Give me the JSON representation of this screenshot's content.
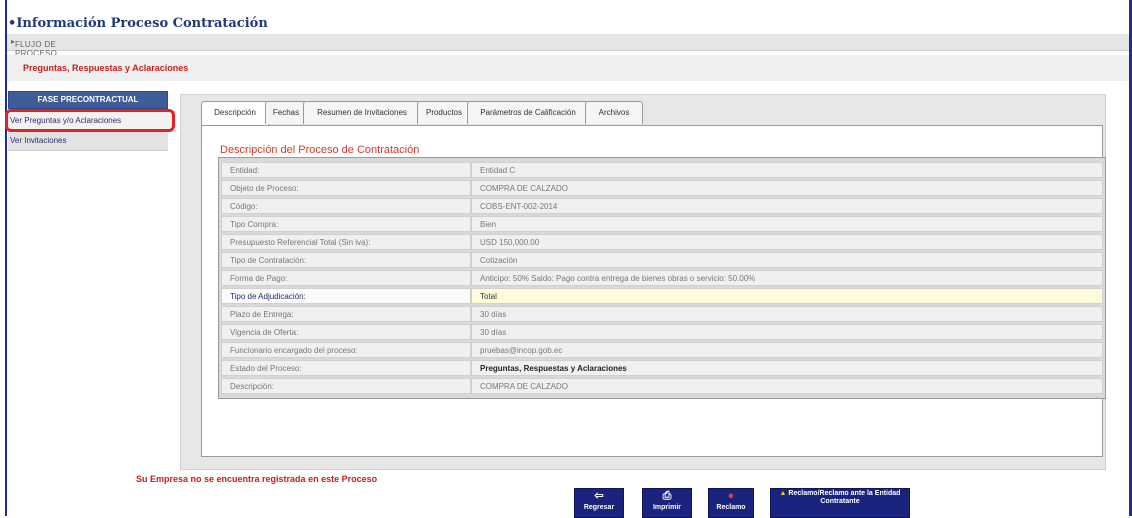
{
  "page_title": "Información Proceso Contratación",
  "flow_link": "FLUJO DE PROCESO",
  "stage_name": "Preguntas, Respuestas y Aclaraciones",
  "sidebar": {
    "header": "FASE PRECONTRACTUAL",
    "items": [
      {
        "label": "Ver Preguntas y/o Aclaraciones",
        "active": true
      },
      {
        "label": "Ver Invitaciones",
        "active": false
      }
    ]
  },
  "tabs": [
    {
      "label": "Descripción",
      "active": true
    },
    {
      "label": "Fechas",
      "active": false
    },
    {
      "label": "Resumen de Invitaciones",
      "active": false
    },
    {
      "label": "Productos",
      "active": false
    },
    {
      "label": "Parámetros de Calificación",
      "active": false
    },
    {
      "label": "Archivos",
      "active": false
    }
  ],
  "section_title": "Descripción del Proceso de Contratación",
  "rows": [
    {
      "label": "Entidad:",
      "value": "Entidad C"
    },
    {
      "label": "Objeto de Proceso:",
      "value": "COMPRA DE CALZADO"
    },
    {
      "label": "Código:",
      "value": "COBS-ENT-002-2014"
    },
    {
      "label": "Tipo Compra:",
      "value": "Bien"
    },
    {
      "label": "Presupuesto Referencial Total (Sin iva):",
      "value": "USD 150,000.00"
    },
    {
      "label": "Tipo de Contratación:",
      "value": "Cotización"
    },
    {
      "label": "Forma de Pago:",
      "value": "Anticipo: 50% Saldo: Pago contra entrega de bienes obras o servicio: 50.00%"
    },
    {
      "label": "Tipo de Adjudicación:",
      "value": "Total"
    },
    {
      "label": "Plazo de Entrega:",
      "value": "30 días"
    },
    {
      "label": "Vigencia de Oferta:",
      "value": "30 días"
    },
    {
      "label": "Funcionario encargado del proceso:",
      "value": "pruebas@incop.gob.ec"
    },
    {
      "label": "Estado del Proceso:",
      "value": "Preguntas, Respuestas y Aclaraciones"
    },
    {
      "label": "Descripción:",
      "value": "COMPRA DE CALZADO"
    }
  ],
  "notice": "Su Empresa no se encuentra registrada en este Proceso",
  "buttons": {
    "regresar": "Regresar",
    "imprimir": "Imprimir",
    "reclamo": "Reclamo",
    "reclamo_entidad": "Reclamo/Reclamo ante la Entidad Contratante"
  },
  "icons": {
    "regresar": "arrow-left-icon",
    "imprimir": "printer-icon",
    "reclamo": "alert-icon",
    "reclamo_entidad": "warning-icon"
  },
  "colors": {
    "title": "#1f3a7a",
    "accent_red": "#c32020",
    "sidebar_header": "#3f5e99",
    "button_bg": "#1a237e",
    "highlight_row": "#fdfbd9"
  }
}
